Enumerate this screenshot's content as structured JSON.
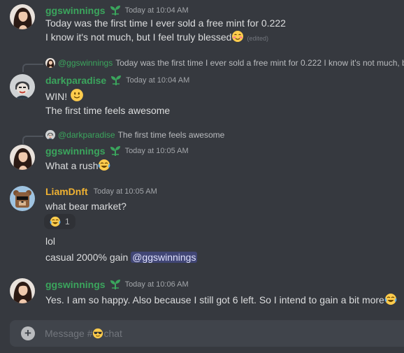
{
  "colors": {
    "background": "#36393f",
    "green_name": "#3ba55d",
    "gold_name": "#f0b232",
    "mention_bg": "#414675"
  },
  "messages": [
    {
      "author": "ggswinnings",
      "time": "Today at 10:04 AM",
      "lines": [
        "Today was the first time I ever sold a free mint for 0.222",
        "I know it's not much, but I feel truly blessed"
      ],
      "edited": "(edited)"
    },
    {
      "reply": {
        "name": "@ggswinnings",
        "text": "Today was the first time I ever sold a free mint for 0.222  I know it's not much, bu"
      },
      "author": "darkparadise",
      "time": "Today at 10:04 AM",
      "lines": [
        "WIN!",
        "The first time feels awesome"
      ]
    },
    {
      "reply": {
        "name": "@darkparadise",
        "text": "The first time feels awesome"
      },
      "author": "ggswinnings",
      "time": "Today at 10:05 AM",
      "lines": [
        "What a rush"
      ]
    },
    {
      "author": "LiamDnft",
      "time": "Today at 10:05 AM",
      "lines": [
        "what bear market?"
      ],
      "reaction": {
        "emoji": "joy",
        "count": "1"
      },
      "more_lines": [
        "lol",
        "casual 2000% gain"
      ],
      "mention": "@ggswinnings"
    },
    {
      "author": "ggswinnings",
      "time": "Today at 10:06 AM",
      "lines": [
        "Yes.  I am so happy.  Also because I still got 6 left.  So I intend to gain a bit more"
      ]
    }
  ],
  "composer": {
    "placeholder_prefix": "Message #",
    "placeholder_suffix": "chat",
    "plus_label": "+"
  },
  "icons": [
    "sprout-badge-icon",
    "smiling-face-icon",
    "slightly-smiling-face-icon",
    "joy-emoji-icon",
    "sunglasses-emoji-icon",
    "add-attachment-icon"
  ]
}
